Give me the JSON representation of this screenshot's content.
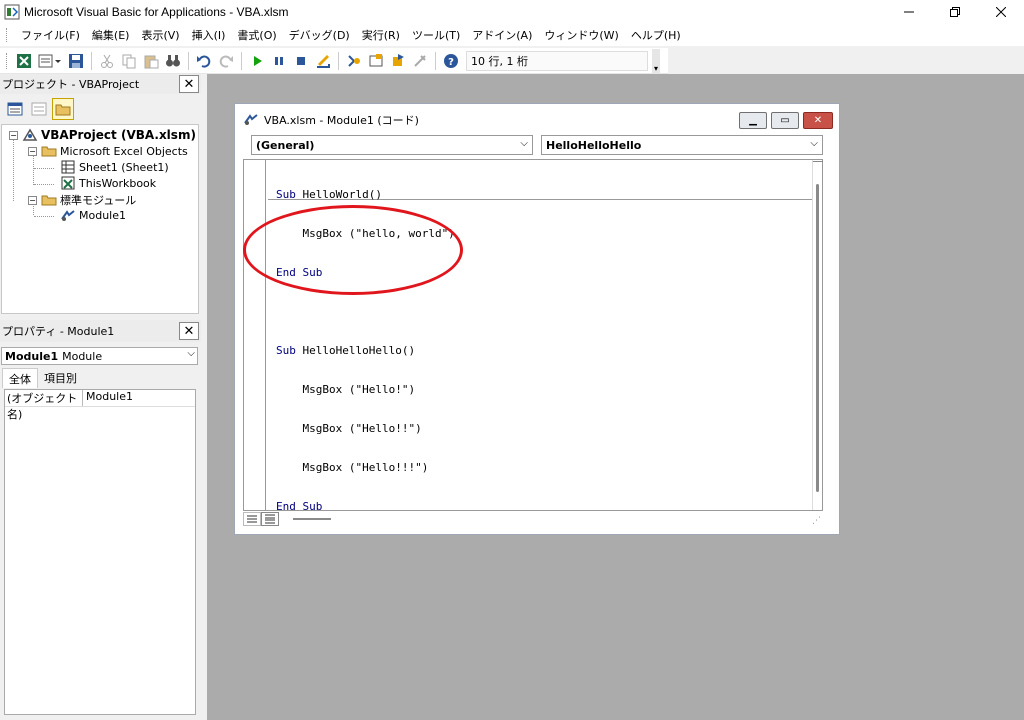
{
  "window": {
    "title": "Microsoft Visual Basic for Applications - VBA.xlsm"
  },
  "menu": {
    "items": [
      "ファイル(F)",
      "編集(E)",
      "表示(V)",
      "挿入(I)",
      "書式(O)",
      "デバッグ(D)",
      "実行(R)",
      "ツール(T)",
      "アドイン(A)",
      "ウィンドウ(W)",
      "ヘルプ(H)"
    ]
  },
  "toolbar": {
    "position_text": "10 行, 1 桁"
  },
  "project": {
    "header": "プロジェクト - VBAProject",
    "root": "VBAProject (VBA.xlsm)",
    "folder_objects": "Microsoft Excel Objects",
    "sheet1": "Sheet1 (Sheet1)",
    "workbook": "ThisWorkbook",
    "folder_modules": "標準モジュール",
    "module1": "Module1"
  },
  "properties": {
    "header": "プロパティ - Module1",
    "combo_name": "Module1",
    "combo_type": "Module",
    "tab_all": "全体",
    "tab_category": "項目別",
    "row_key": "(オブジェクト名)",
    "row_value": "Module1"
  },
  "codewin": {
    "title": "VBA.xlsm - Module1 (コード)",
    "object_combo": "(General)",
    "proc_combo": "HelloHelloHello",
    "lines": [
      {
        "kw": "Sub",
        "rest": " HelloWorld()"
      },
      {
        "kw": "",
        "rest": "    MsgBox (\"hello, world\")"
      },
      {
        "kw": "End Sub",
        "rest": ""
      },
      {
        "kw": "",
        "rest": ""
      },
      {
        "kw": "Sub",
        "rest": " HelloHelloHello()"
      },
      {
        "kw": "",
        "rest": "    MsgBox (\"Hello!\")"
      },
      {
        "kw": "",
        "rest": "    MsgBox (\"Hello!!\")"
      },
      {
        "kw": "",
        "rest": "    MsgBox (\"Hello!!!\")"
      },
      {
        "kw": "End Sub",
        "rest": ""
      }
    ]
  },
  "colors": {
    "keyword": "#00007f",
    "annotation": "#e0161c",
    "mdi_background": "#ababab"
  }
}
